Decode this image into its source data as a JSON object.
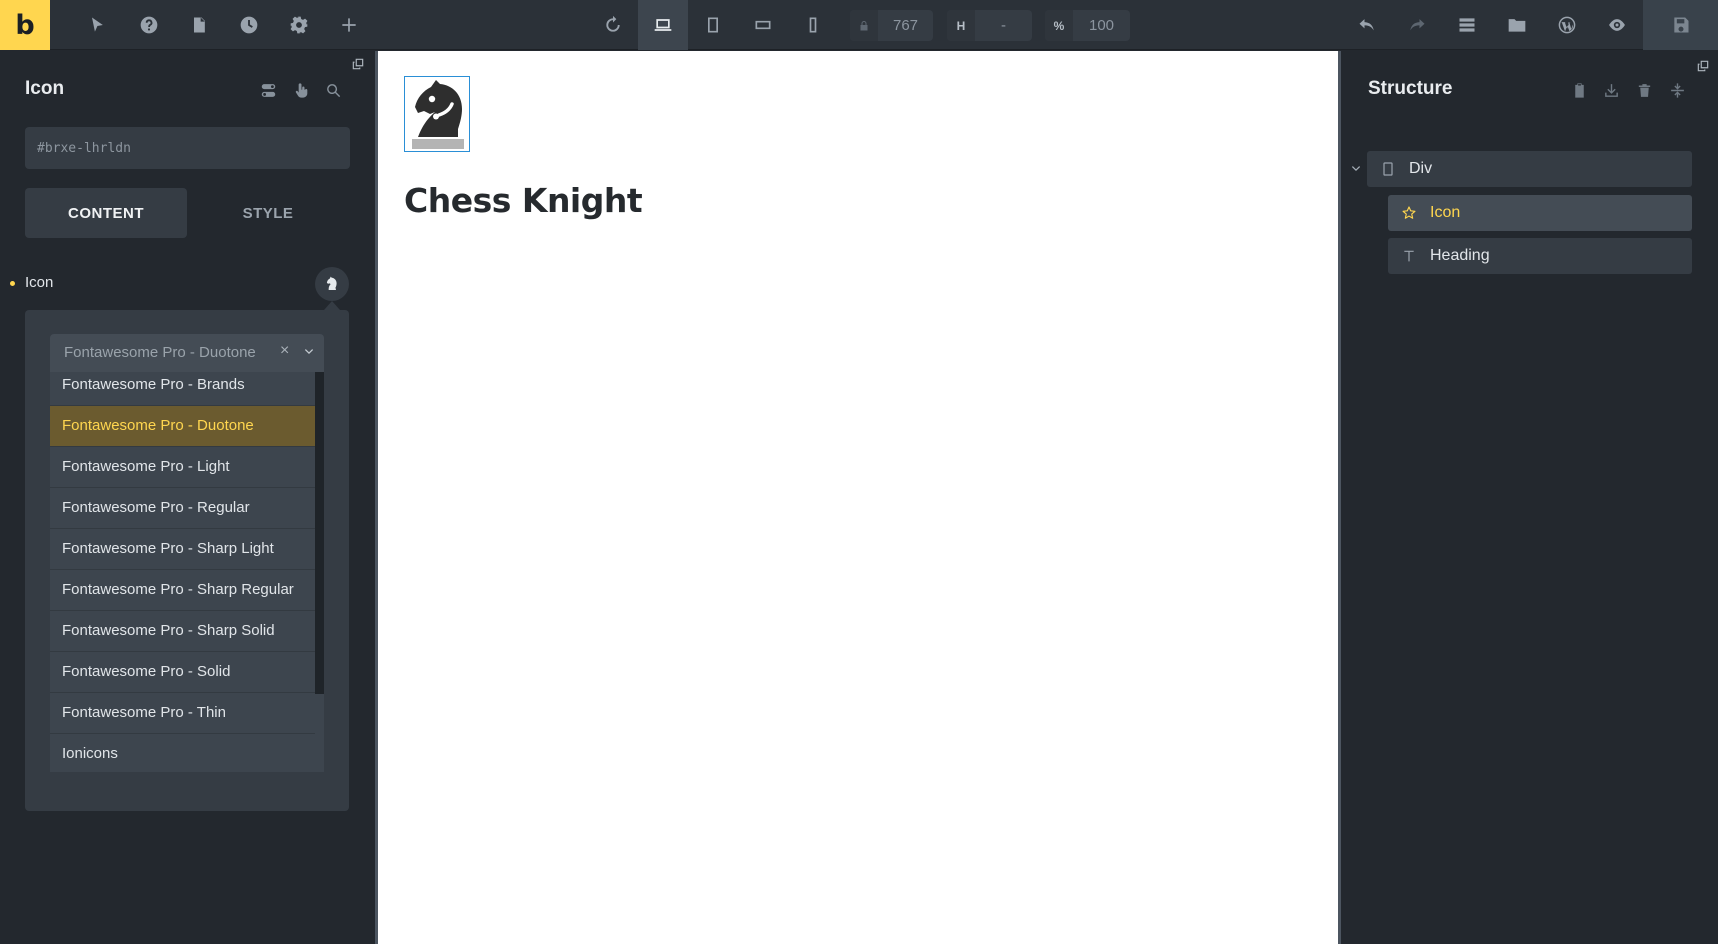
{
  "topbar": {
    "logo": "b",
    "width_value": "767",
    "height_prefix": "H",
    "height_value": "-",
    "zoom_prefix": "%",
    "zoom_value": "100"
  },
  "left_panel": {
    "title": "Icon",
    "css_id": "#brxe-lhrldn",
    "tabs": {
      "content": "CONTENT",
      "style": "STYLE"
    },
    "icon_control_label": "Icon",
    "icon_library": {
      "selected": "Fontawesome Pro - Duotone",
      "clear_symbol": "×",
      "options": [
        "Fontawesome Pro - Brands",
        "Fontawesome Pro - Duotone",
        "Fontawesome Pro - Light",
        "Fontawesome Pro - Regular",
        "Fontawesome Pro - Sharp Light",
        "Fontawesome Pro - Sharp Regular",
        "Fontawesome Pro - Sharp Solid",
        "Fontawesome Pro - Solid",
        "Fontawesome Pro - Thin",
        "Ionicons"
      ]
    }
  },
  "canvas": {
    "icon_name": "chess-knight-icon",
    "heading": "Chess Knight"
  },
  "structure": {
    "title": "Structure",
    "tree": [
      {
        "label": "Div",
        "icon": "div-icon"
      },
      {
        "label": "Icon",
        "icon": "star-icon",
        "selected": true
      },
      {
        "label": "Heading",
        "icon": "heading-icon"
      }
    ]
  },
  "colors": {
    "accent": "#ffd64f",
    "panel_bg": "#23282e",
    "selection": "#2a8fd6"
  }
}
